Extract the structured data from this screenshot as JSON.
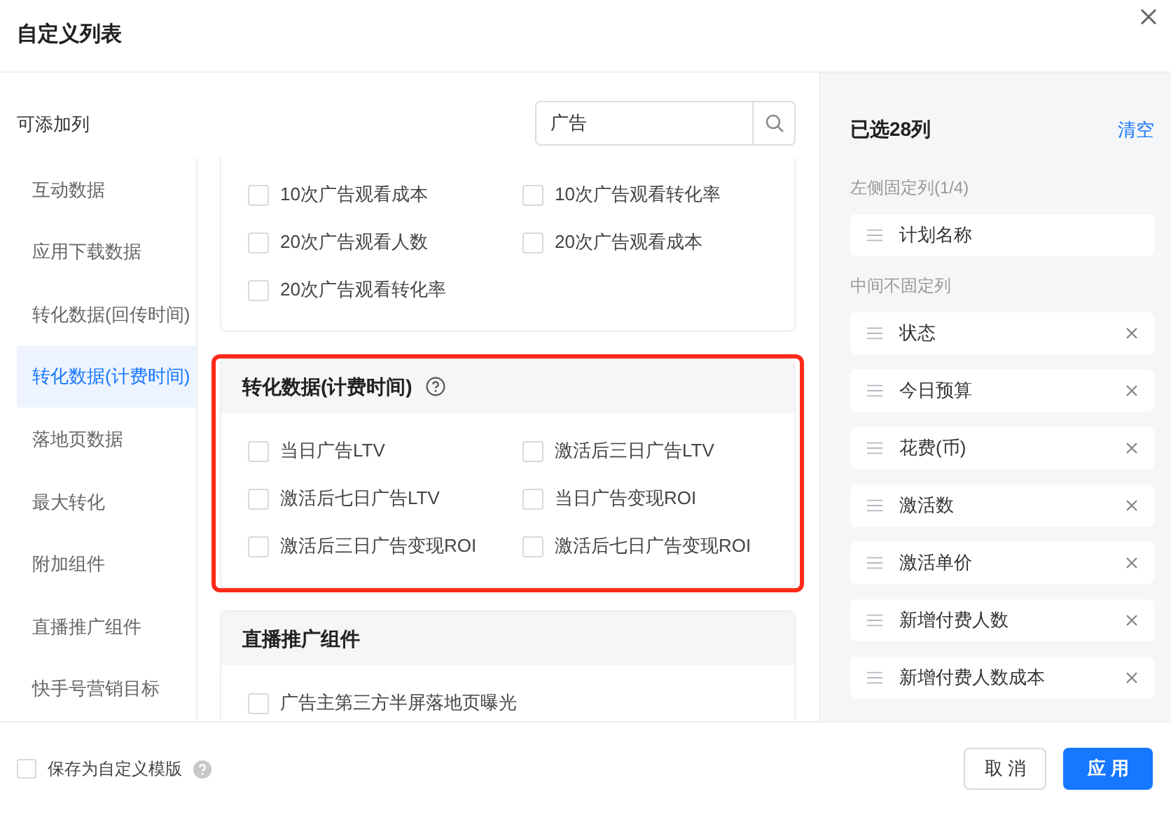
{
  "dialog": {
    "title": "自定义列表"
  },
  "available": {
    "label": "可添加列",
    "search": {
      "value": "广告"
    }
  },
  "nav": [
    {
      "label": "互动数据",
      "selected": false
    },
    {
      "label": "应用下载数据",
      "selected": false
    },
    {
      "label": "转化数据(回传时间)",
      "selected": false
    },
    {
      "label": "转化数据(计费时间)",
      "selected": true
    },
    {
      "label": "落地页数据",
      "selected": false
    },
    {
      "label": "最大转化",
      "selected": false
    },
    {
      "label": "附加组件",
      "selected": false
    },
    {
      "label": "直播推广组件",
      "selected": false
    },
    {
      "label": "快手号营销目标",
      "selected": false
    }
  ],
  "sections": [
    {
      "highlighted": false,
      "options": [
        {
          "label": "10次广告观看成本",
          "checked": false
        },
        {
          "label": "10次广告观看转化率",
          "checked": false
        },
        {
          "label": "20次广告观看人数",
          "checked": false
        },
        {
          "label": "20次广告观看成本",
          "checked": false
        },
        {
          "label": "20次广告观看转化率",
          "checked": false
        }
      ]
    },
    {
      "title": "转化数据(计费时间)",
      "help": true,
      "highlighted": true,
      "options": [
        {
          "label": "当日广告LTV",
          "checked": false
        },
        {
          "label": "激活后三日广告LTV",
          "checked": false
        },
        {
          "label": "激活后七日广告LTV",
          "checked": false
        },
        {
          "label": "当日广告变现ROI",
          "checked": false
        },
        {
          "label": "激活后三日广告变现ROI",
          "checked": false
        },
        {
          "label": "激活后七日广告变现ROI",
          "checked": false
        }
      ]
    },
    {
      "title": "直播推广组件",
      "help": false,
      "highlighted": false,
      "options": [
        {
          "label": "广告主第三方半屏落地页曝光",
          "checked": false
        }
      ]
    }
  ],
  "selected_panel": {
    "title": "已选28列",
    "clear": "清空",
    "fixed_label": "左侧固定列(1/4)",
    "fixed_columns": [
      {
        "label": "计划名称",
        "removable": false
      }
    ],
    "middle_label": "中间不固定列",
    "middle_columns": [
      {
        "label": "状态",
        "removable": true
      },
      {
        "label": "今日预算",
        "removable": true
      },
      {
        "label": "花费(币)",
        "removable": true
      },
      {
        "label": "激活数",
        "removable": true
      },
      {
        "label": "激活单价",
        "removable": true
      },
      {
        "label": "新增付费人数",
        "removable": true
      },
      {
        "label": "新增付费人数成本",
        "removable": true
      }
    ]
  },
  "footer": {
    "save_template": {
      "label": "保存为自定义模版",
      "checked": false
    },
    "buttons": [
      {
        "kind": "secondary",
        "label": "取 消"
      },
      {
        "kind": "primary",
        "label": "应 用"
      }
    ]
  }
}
